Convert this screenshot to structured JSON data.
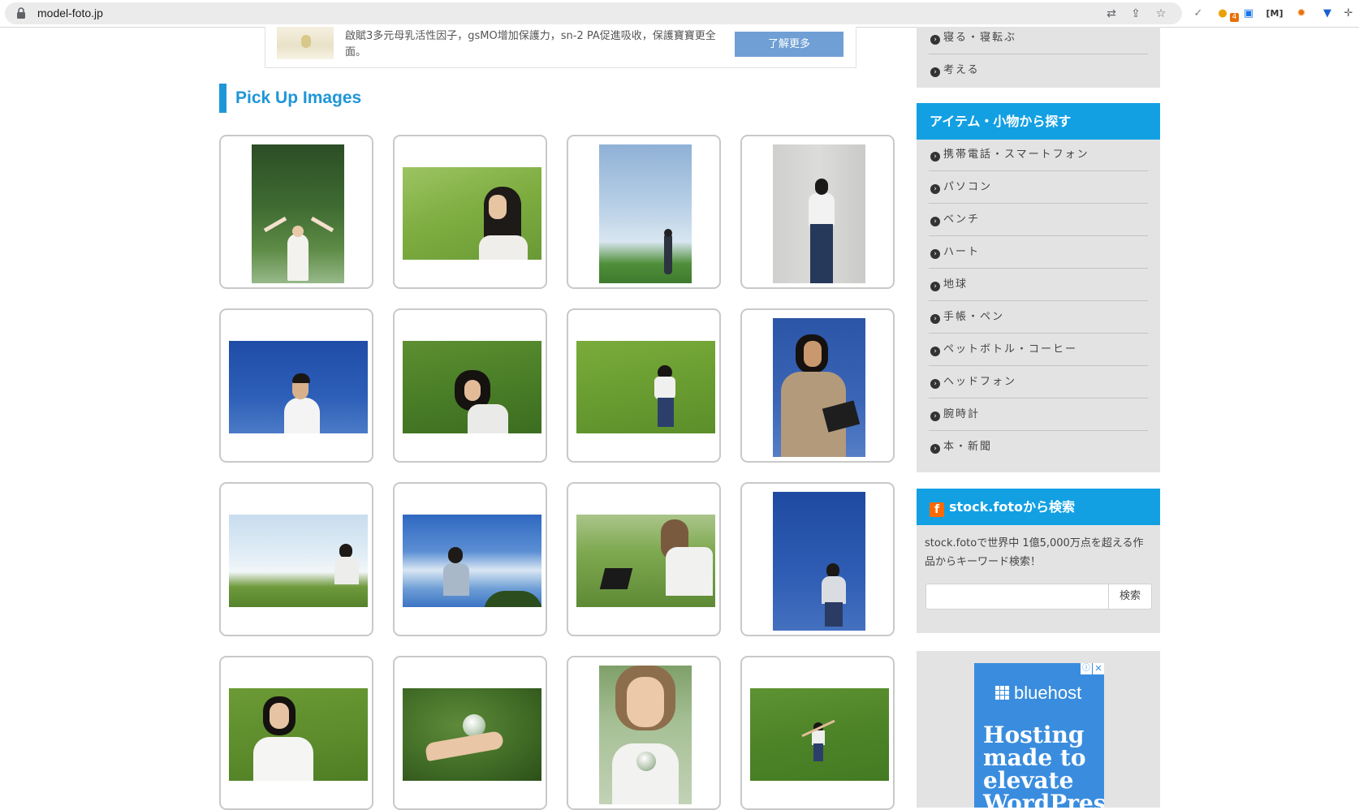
{
  "browser": {
    "url": "model-foto.jp",
    "extension_badge": "4"
  },
  "ad_top": {
    "text": "啟賦3多元母乳活性因子，gsMO增加保護力，sn-2 PA促進吸收，保護寶寶更全面。",
    "button": "了解更多"
  },
  "main": {
    "section_title": "Pick Up Images"
  },
  "sidebar": {
    "prev_items": [
      "寝る・寝転ぶ",
      "考える"
    ],
    "items_heading": "アイテム・小物から探す",
    "items": [
      "携帯電話・スマートフォン",
      "パソコン",
      "ベンチ",
      "ハート",
      "地球",
      "手帳・ペン",
      "ペットボトル・コーヒー",
      "ヘッドフォン",
      "腕時計",
      "本・新聞"
    ],
    "search_heading": "stock.fotoから検索",
    "search_logo": "f",
    "search_description": "stock.fotoで世界中 1億5,000万点を超える作品からキーワード検索！",
    "search_button": "検索"
  },
  "ad_side": {
    "brand": "bluehost",
    "headline": "Hosting made to elevate WordPress"
  },
  "colors": {
    "accent": "#12a0e3",
    "title_blue": "#1e96d8",
    "sidebar_bg": "#e3e3e3"
  }
}
